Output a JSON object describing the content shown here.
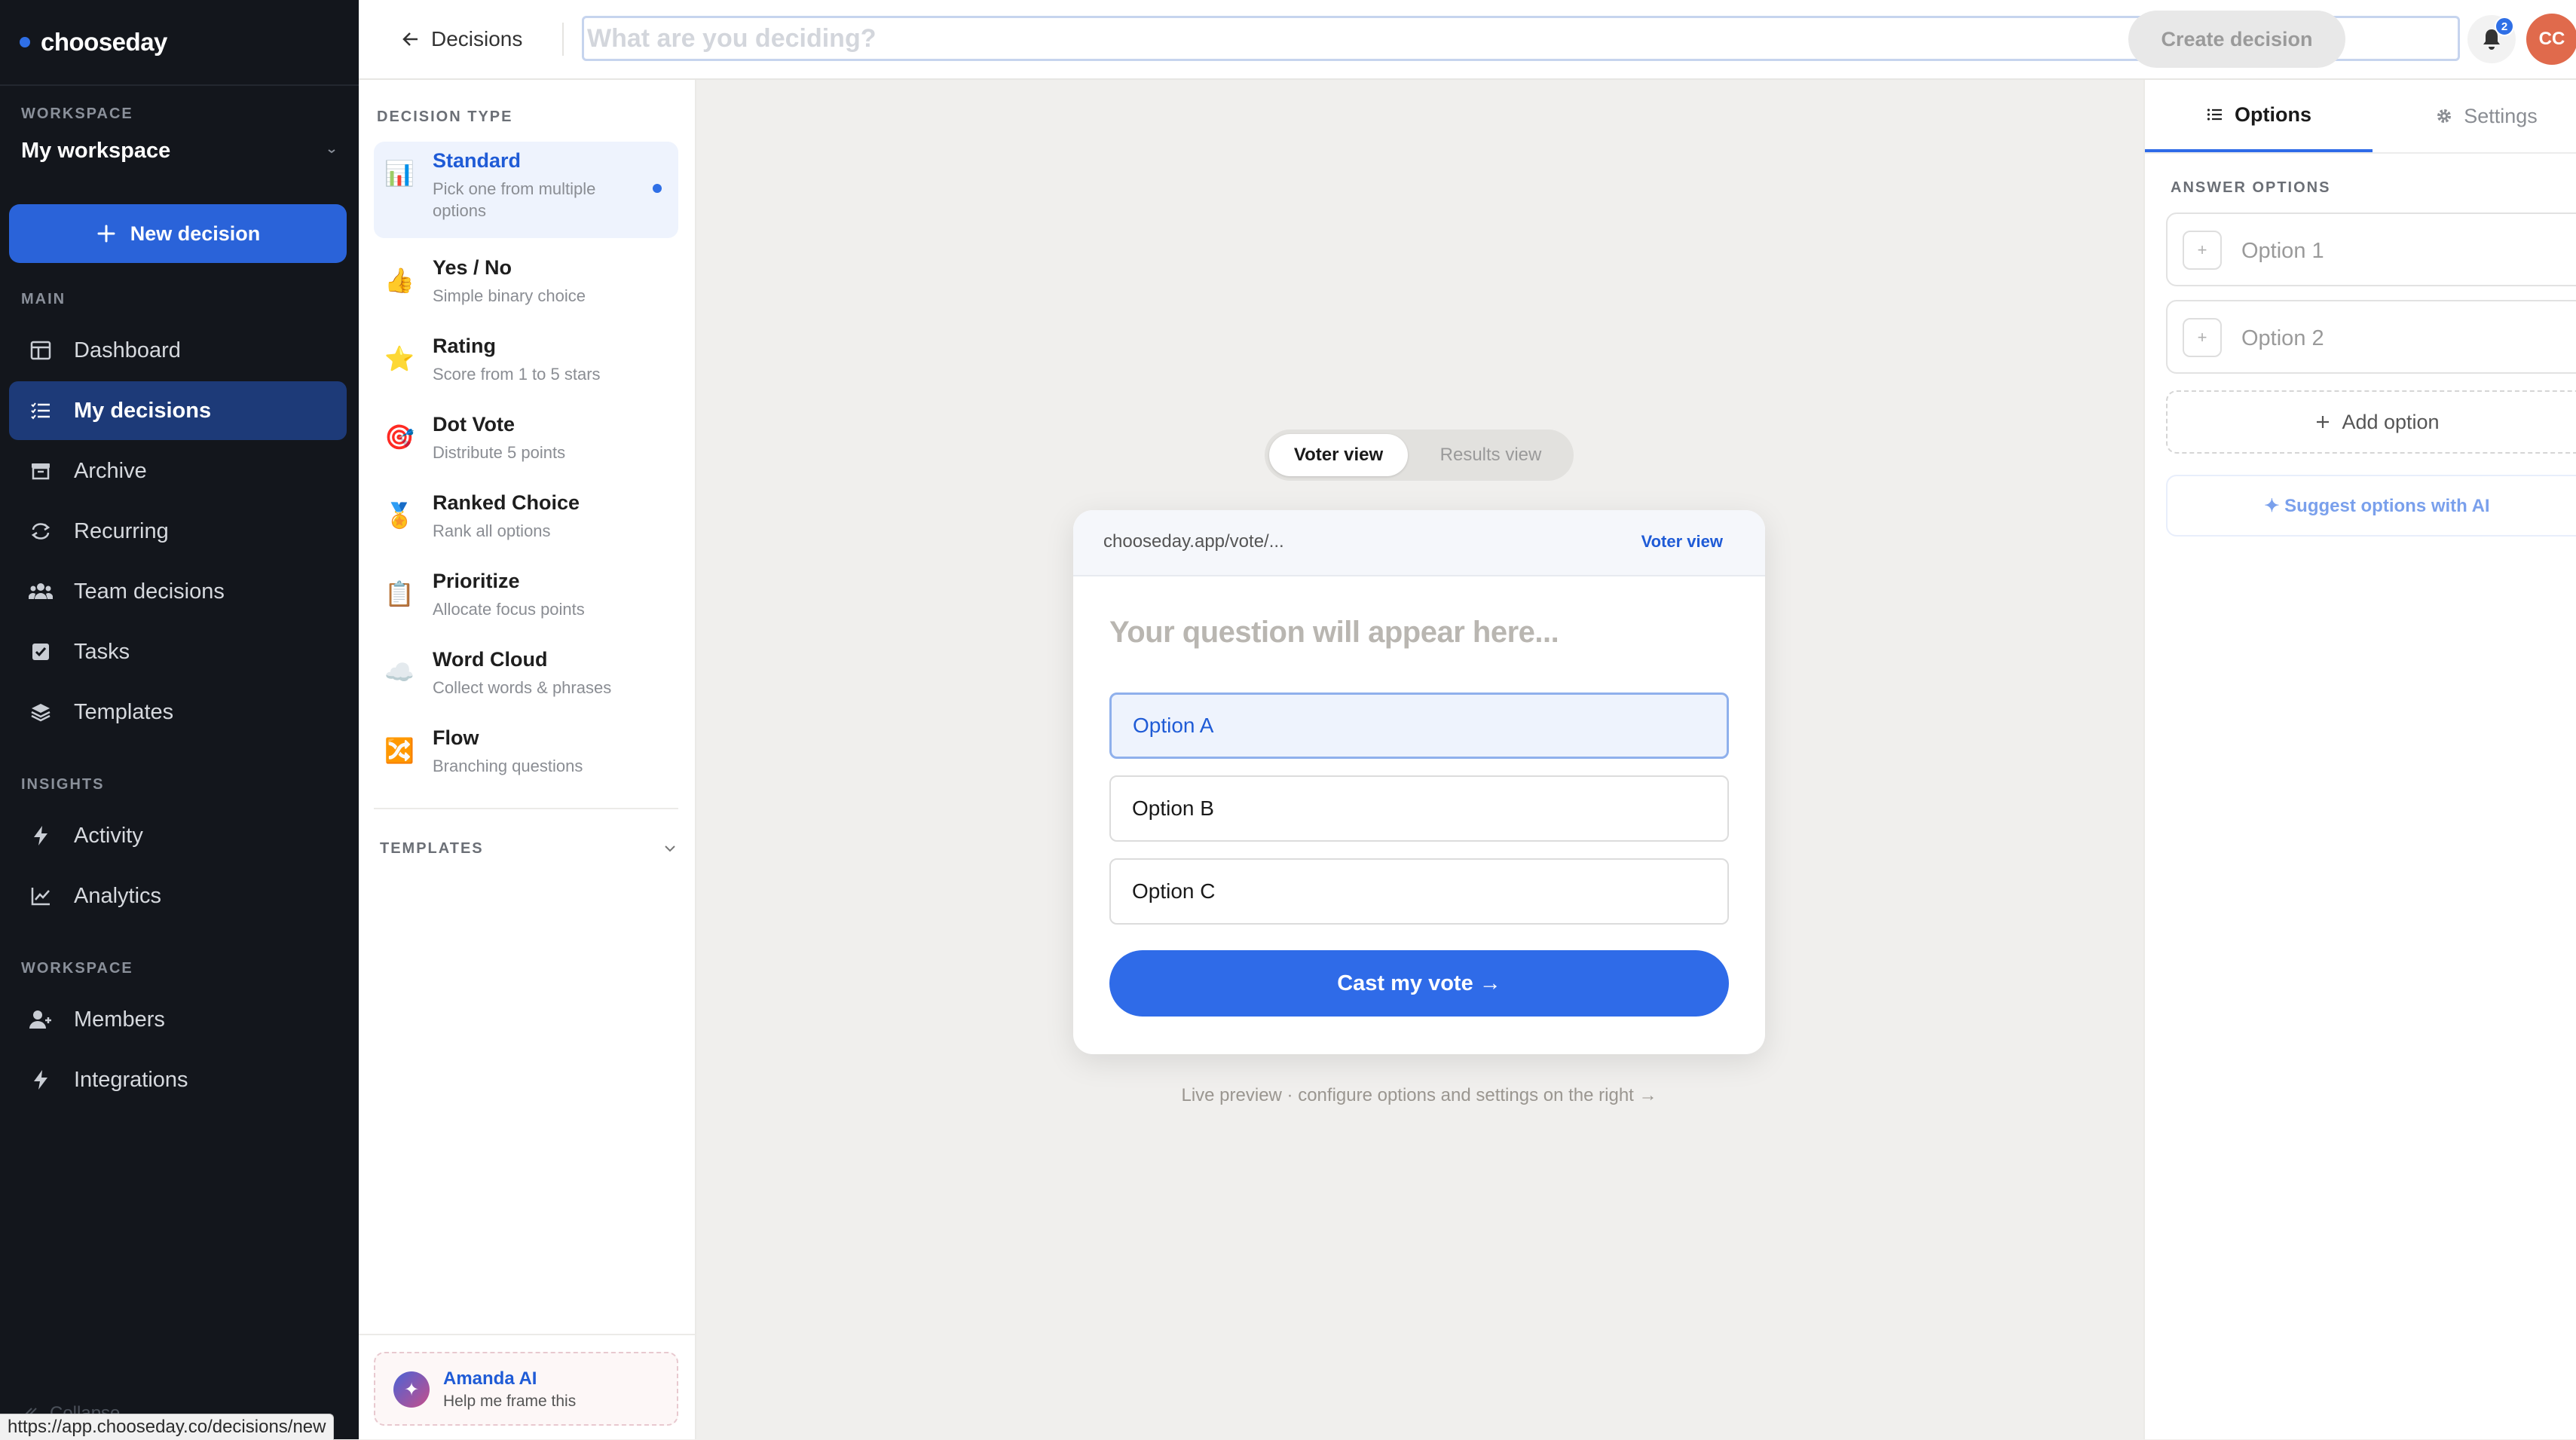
{
  "brand": {
    "name": "chooseday"
  },
  "sidebar": {
    "workspace_section": "WORKSPACE",
    "workspace_name": "My workspace",
    "new_decision_label": "New decision",
    "main_section": "MAIN",
    "main_items": [
      {
        "label": "Dashboard",
        "icon": "dashboard-icon"
      },
      {
        "label": "My decisions",
        "icon": "list-icon",
        "active": true
      },
      {
        "label": "Archive",
        "icon": "archive-icon"
      },
      {
        "label": "Recurring",
        "icon": "repeat-icon"
      },
      {
        "label": "Team decisions",
        "icon": "team-icon"
      },
      {
        "label": "Tasks",
        "icon": "checkbox-icon"
      },
      {
        "label": "Templates",
        "icon": "layers-icon"
      }
    ],
    "insights_section": "INSIGHTS",
    "insights_items": [
      {
        "label": "Activity",
        "icon": "lightning-icon"
      },
      {
        "label": "Analytics",
        "icon": "chart-line-icon"
      }
    ],
    "workspace_section_2": "WORKSPACE",
    "workspace_items": [
      {
        "label": "Members",
        "icon": "user-add-icon"
      },
      {
        "label": "Integrations",
        "icon": "lightning-icon"
      }
    ],
    "collapse_label": "Collapse"
  },
  "status_url": "https://app.chooseday.co/decisions/new",
  "topbar": {
    "back_label": "Decisions",
    "title_placeholder": "What are you deciding?",
    "create_label": "Create decision",
    "notification_count": "2",
    "avatar_initials": "CC"
  },
  "decision_types": {
    "title": "DECISION TYPE",
    "items": [
      {
        "name": "Standard",
        "desc": "Pick one from multiple options",
        "emoji": "📊",
        "selected": true
      },
      {
        "name": "Yes / No",
        "desc": "Simple binary choice",
        "emoji": "👍"
      },
      {
        "name": "Rating",
        "desc": "Score from 1 to 5 stars",
        "emoji": "⭐"
      },
      {
        "name": "Dot Vote",
        "desc": "Distribute 5 points",
        "emoji": "🎯"
      },
      {
        "name": "Ranked Choice",
        "desc": "Rank all options",
        "emoji": "🏅"
      },
      {
        "name": "Prioritize",
        "desc": "Allocate focus points",
        "emoji": "📋"
      },
      {
        "name": "Word Cloud",
        "desc": "Collect words & phrases",
        "emoji": "☁️"
      },
      {
        "name": "Flow",
        "desc": "Branching questions",
        "emoji": "🔀"
      }
    ],
    "templates_label": "TEMPLATES",
    "ai": {
      "name": "Amanda AI",
      "subtitle": "Help me frame this"
    }
  },
  "preview": {
    "toggle": {
      "voter": "Voter view",
      "results": "Results view"
    },
    "url": "chooseday.app/vote/...",
    "badge": "Voter view",
    "question_placeholder": "Your question will appear here...",
    "options": [
      "Option A",
      "Option B",
      "Option C"
    ],
    "selected_option": "Option A",
    "cast_label": "Cast my vote →",
    "note": "Live preview · configure options and settings on the right →"
  },
  "right_panel": {
    "tab_options": "Options",
    "tab_settings": "Settings",
    "section_title": "ANSWER OPTIONS",
    "answer_placeholders": [
      "Option 1",
      "Option 2"
    ],
    "add_option_label": "Add option",
    "suggest_label": "✦ Suggest options with AI"
  },
  "colors": {
    "accent": "#2f6be8",
    "sidebar_bg": "#13161c",
    "sidebar_active": "#1d3a78",
    "canvas_bg": "#f0efed",
    "avatar": "#e06a4c"
  }
}
